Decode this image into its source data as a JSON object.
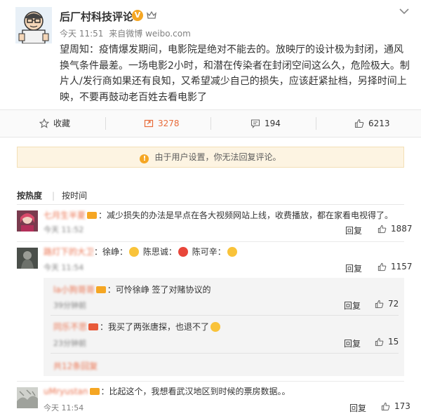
{
  "post": {
    "author": "后厂村科技评论",
    "verified_badge": "V",
    "time": "今天 11:51",
    "source_prefix": "来自",
    "source": "微博 weibo.com",
    "content": "望周知：疫情爆发期间，电影院是绝对不能去的。放映厅的设计极为封闭，通风换气条件最差。一场电影2小时，和潜在传染者在封闭空间这么久，危险极大。制片人/发行商如果还有良知，又希望减少自己的损失，应该赶紧扯档，另择时间上映，不要再鼓动老百姓去看电影了"
  },
  "actions": {
    "collect_label": "收藏",
    "repost_count": "3278",
    "comment_count": "194",
    "like_count": "6213"
  },
  "notice": "由于用户设置，你无法回复评论。",
  "sort": {
    "hot": "按热度",
    "time": "按时间"
  },
  "comments": [
    {
      "name": "七月生半夏",
      "text": "：减少损失的办法是早点在各大视频网站上线，收费播放，都在家看电视得了。",
      "time": "今天 11:52",
      "reply": "回复",
      "likes": "1887"
    },
    {
      "name": "路灯下的大卫",
      "text_a": "：徐峥：",
      "text_b": "陈思诚：",
      "text_c": "陈可辛：",
      "time": "今天 11:54",
      "reply": "回复",
      "likes": "1157"
    }
  ],
  "subcomments": [
    {
      "name": "la小狗哥哥",
      "text": "：可怜徐峥 签了对赌协议的",
      "time": "39分钟前",
      "reply": "回复",
      "likes": "72"
    },
    {
      "name": "同乐不思",
      "text": "：我买了两张唐探，也退不了",
      "time": "23分钟前",
      "reply": "回复",
      "likes": "15"
    }
  ],
  "more_replies": "共12条回复",
  "comment3": {
    "name": "uMryustan",
    "text": "：比起这个，我想看武汉地区到时候的票房数据。。",
    "time": "今天 11:54",
    "reply": "回复",
    "likes": "173"
  },
  "colors": {
    "name_orange": "#eb7350",
    "notice_bg": "#fdf4e2",
    "badge_gold": "#f5a623"
  }
}
